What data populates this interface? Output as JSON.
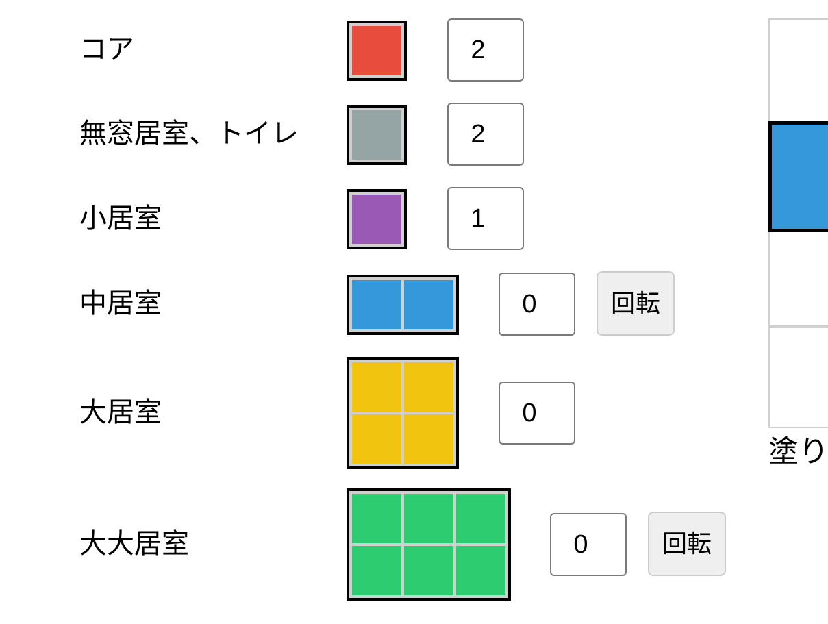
{
  "pieces": [
    {
      "label": "コア",
      "color": "#e74c3c",
      "cols": 1,
      "rows": 1,
      "count": "2",
      "rotatable": false
    },
    {
      "label": "無窓居室、トイレ",
      "color": "#95a5a6",
      "cols": 1,
      "rows": 1,
      "count": "2",
      "rotatable": false
    },
    {
      "label": "小居室",
      "color": "#9b59b6",
      "cols": 1,
      "rows": 1,
      "count": "1",
      "rotatable": false
    },
    {
      "label": "中居室",
      "color": "#3498db",
      "cols": 2,
      "rows": 1,
      "count": "0",
      "rotatable": true
    },
    {
      "label": "大居室",
      "color": "#f1c40f",
      "cols": 2,
      "rows": 2,
      "count": "0",
      "rotatable": false
    },
    {
      "label": "大大居室",
      "color": "#2ecc71",
      "cols": 3,
      "rows": 2,
      "count": "0",
      "rotatable": true
    }
  ],
  "rotate_label": "回転",
  "board": {
    "placed_piece_color": "#3498db",
    "status_text": "塗り"
  }
}
